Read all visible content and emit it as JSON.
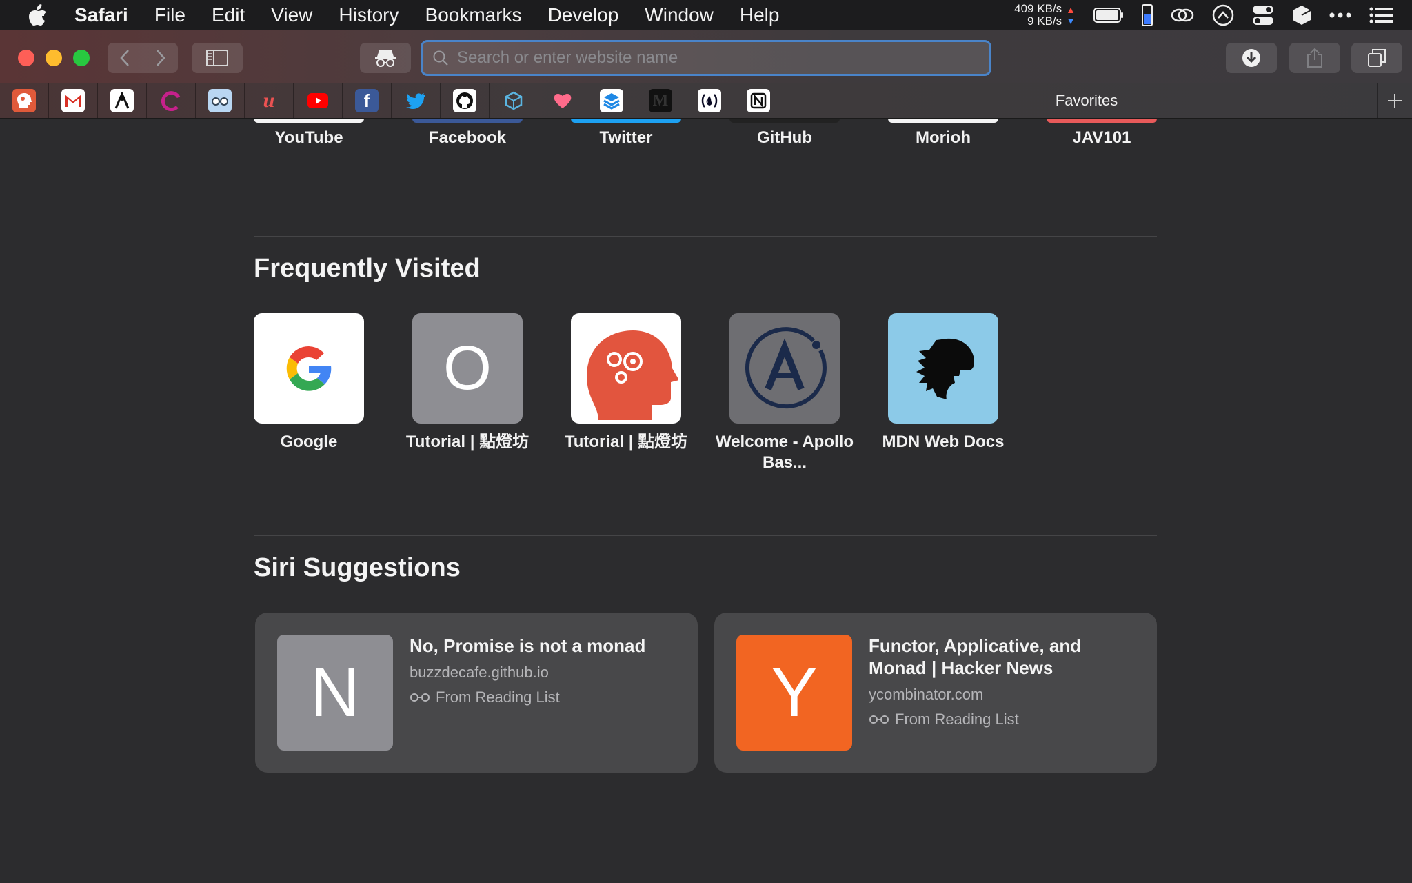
{
  "menubar": {
    "app": "Safari",
    "items": [
      "File",
      "Edit",
      "View",
      "History",
      "Bookmarks",
      "Develop",
      "Window",
      "Help"
    ],
    "net_up": "409 KB/s",
    "net_down": "9 KB/s",
    "up_arrow": "▲",
    "down_arrow": "▼"
  },
  "toolbar": {
    "address_placeholder": "Search or enter website name"
  },
  "favorites_bar": {
    "label": "Favorites",
    "icons": [
      "brain-icon",
      "gmail-icon",
      "app-icon",
      "ring-icon",
      "glasses-icon",
      "udemy-icon",
      "youtube-icon",
      "facebook-icon",
      "twitter-icon",
      "github-icon",
      "codesandbox-icon",
      "heart-icon",
      "stack-icon",
      "medium-icon",
      "freecodecamp-icon",
      "notion-icon"
    ]
  },
  "favorites_row": {
    "labels": [
      "YouTube",
      "Facebook",
      "Twitter",
      "GitHub",
      "Morioh",
      "JAV101"
    ]
  },
  "frequently_visited": {
    "title": "Frequently Visited",
    "sites": [
      {
        "label": "Google",
        "letter": ""
      },
      {
        "label": "Tutorial | 點燈坊",
        "letter": "O"
      },
      {
        "label": "Tutorial | 點燈坊",
        "letter": ""
      },
      {
        "label": "Welcome - Apollo Bas...",
        "letter": "A"
      },
      {
        "label": "MDN Web Docs",
        "letter": ""
      }
    ]
  },
  "siri_suggestions": {
    "title": "Siri Suggestions",
    "cards": [
      {
        "letter": "N",
        "title": "No, Promise is not a monad",
        "domain": "buzzdecafe.github.io",
        "source": "From Reading List",
        "color": "#8e8e93"
      },
      {
        "letter": "Y",
        "title": "Functor, Applicative, and Monad | Hacker News",
        "domain": "ycombinator.com",
        "source": "From Reading List",
        "color": "#f26522"
      }
    ]
  },
  "colors": {
    "accent": "#4a84c9",
    "background": "#2c2c2e"
  }
}
